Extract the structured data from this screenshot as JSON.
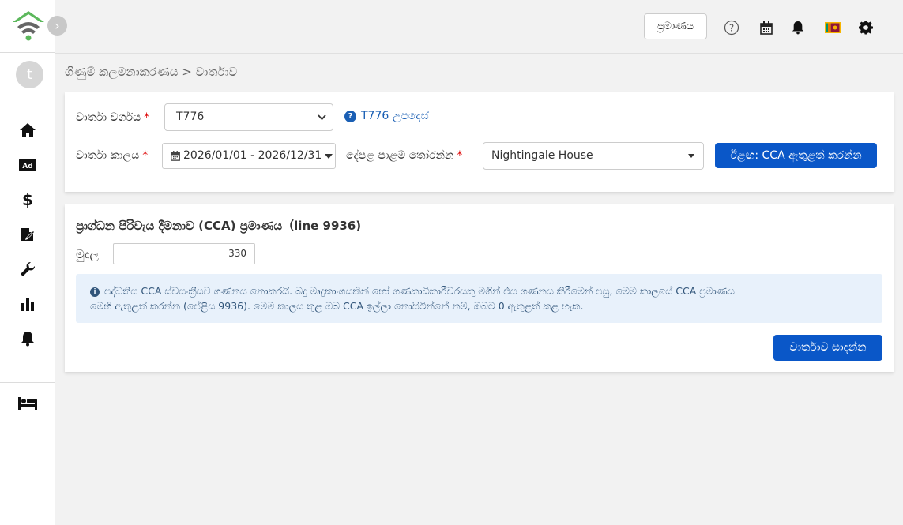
{
  "header": {
    "certificate_button": "ප්‍රමාණය",
    "flag_icon": "sri-lanka-flag",
    "icons": [
      "help-icon",
      "calendar-icon",
      "bell-icon",
      "gear-icon"
    ]
  },
  "sidebar": {
    "avatar_initial": "t",
    "items": [
      "home-icon",
      "ad-icon",
      "dollar-icon",
      "edit-document-icon",
      "wrench-icon",
      "bar-chart-icon",
      "bell-icon",
      "bed-icon"
    ]
  },
  "breadcrumb": "ගිණුම් කලමනාකරණය > වාර්තාව",
  "filters": {
    "report_type_label": "වාර්තා වර්ගය",
    "report_type_value": "T776",
    "help_link": "T776 උපදෙස්",
    "report_period_label": "වාර්තා කාලය",
    "report_period_value": "2026/01/01 - 2026/12/31",
    "property_label": "දේපළ පාළම තෝරන්න",
    "property_value": "Nightingale House",
    "next_button": "ඊළඟ: CCA ඇතුළත් කරන්න"
  },
  "cca": {
    "title": "ප්‍රාග්ධන පිරිවැය දීමනාව (CCA) ප්‍රමාණය（line 9936)",
    "amount_label": "මුදල",
    "amount_value": "330",
    "info_line1": "පද්ධතිය CCA ස්වයංක්‍රීයව ගණනය නොකරයි. බදු මෘදුකාංගයකින් හෝ ගණකාධිකාරීවරයකු මගින් එය ගණනය කිරීමෙන් පසු, මෙම කාලයේ CCA ප්‍රමාණය",
    "info_line2": "මෙහි ඇතුළත් කරන්න (පේළිය 9936). මෙම කාලය තුළ ඔබ CCA ඉල්ලා නොසිටින්නේ නම්, ඔබට 0 ඇතුළත් කළ හැක.",
    "save_button": "වාර්තාව සාදන්න"
  },
  "colors": {
    "primary": "#0a57c8",
    "info_bg": "#e8f1fb",
    "logo_green": "#5cb85c",
    "logo_gray": "#666666"
  }
}
